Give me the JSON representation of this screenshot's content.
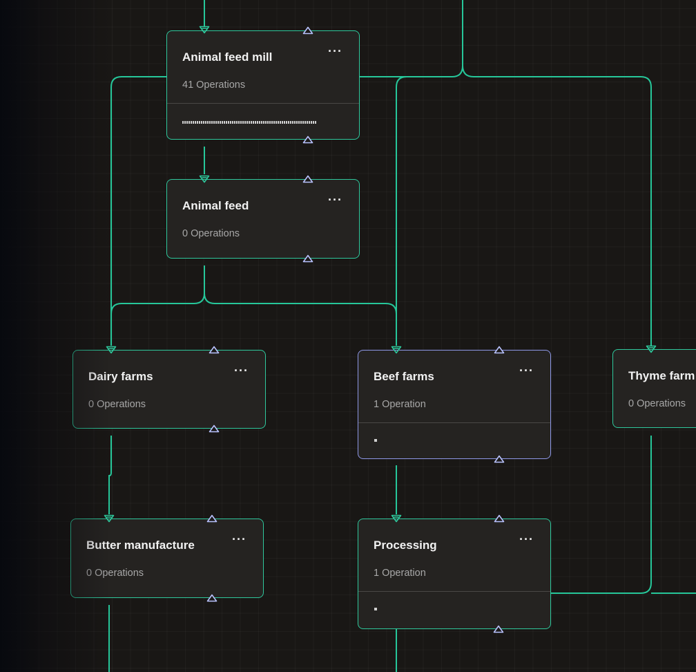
{
  "colors": {
    "background": "#191715",
    "node_fill": "#252321",
    "node_border": "#2fc99d",
    "selected_border": "#8f99e8",
    "wire": "#26c79a",
    "input_port": "#2fc99d",
    "output_port": "#b9c3ff",
    "title_text": "#f2f2f2",
    "subtitle_text": "#a8a8a8"
  },
  "icons": {
    "menu": "more-horizontal-icon",
    "input_port": "triangle-down-icon",
    "output_port": "triangle-up-icon"
  },
  "menu_glyph": "···",
  "nodes": {
    "animal_feed_mill": {
      "title": "Animal feed mill",
      "subtitle": "41 Operations",
      "operations": 41
    },
    "animal_feed": {
      "title": "Animal feed",
      "subtitle": "0 Operations",
      "operations": 0
    },
    "dairy_farms": {
      "title": "Dairy farms",
      "subtitle": "0 Operations",
      "operations": 0
    },
    "beef_farms": {
      "title": "Beef farms",
      "subtitle": "1 Operation",
      "operations": 1,
      "selected": true
    },
    "thyme_farm": {
      "title": "Thyme farm",
      "subtitle": "0 Operations",
      "operations": 0
    },
    "butter_manufacture": {
      "title": "Butter manufacture",
      "subtitle": "0 Operations",
      "operations": 0
    },
    "processing": {
      "title": "Processing",
      "subtitle": "1 Operation",
      "operations": 1
    }
  },
  "connections": [
    {
      "from": "animal_feed_mill",
      "to": "animal_feed"
    },
    {
      "from": "animal_feed",
      "to": "dairy_farms"
    },
    {
      "from": "animal_feed",
      "to": "beef_farms"
    },
    {
      "from": "dairy_farms",
      "to": "butter_manufacture"
    },
    {
      "from": "beef_farms",
      "to": "processing"
    }
  ]
}
